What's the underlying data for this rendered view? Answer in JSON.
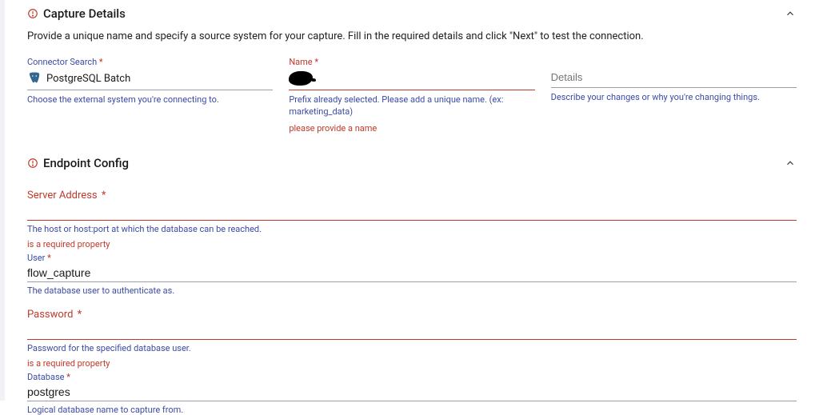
{
  "capture": {
    "title": "Capture Details",
    "intro": "Provide a unique name and specify a source system for your capture. Fill in the required details and click \"Next\" to test the connection.",
    "connector": {
      "label": "Connector Search",
      "value": "PostgreSQL Batch",
      "helper": "Choose the external system you're connecting to.",
      "icon_name": "postgres-icon"
    },
    "name": {
      "label": "Name",
      "value": "",
      "helper": "Prefix already selected. Please add a unique name. (ex: marketing_data)",
      "error": "please provide a name"
    },
    "details": {
      "label": "Details",
      "helper": "Describe your changes or why you're changing things."
    }
  },
  "endpoint": {
    "title": "Endpoint Config",
    "server": {
      "label": "Server Address",
      "value": "",
      "helper": "The host or host:port at which the database can be reached.",
      "error": "is a required property"
    },
    "user": {
      "label": "User",
      "value": "flow_capture",
      "helper": "The database user to authenticate as."
    },
    "password": {
      "label": "Password",
      "value": "",
      "helper": "Password for the specified database user.",
      "error": "is a required property"
    },
    "database": {
      "label": "Database",
      "value": "postgres",
      "helper": "Logical database name to capture from."
    }
  }
}
